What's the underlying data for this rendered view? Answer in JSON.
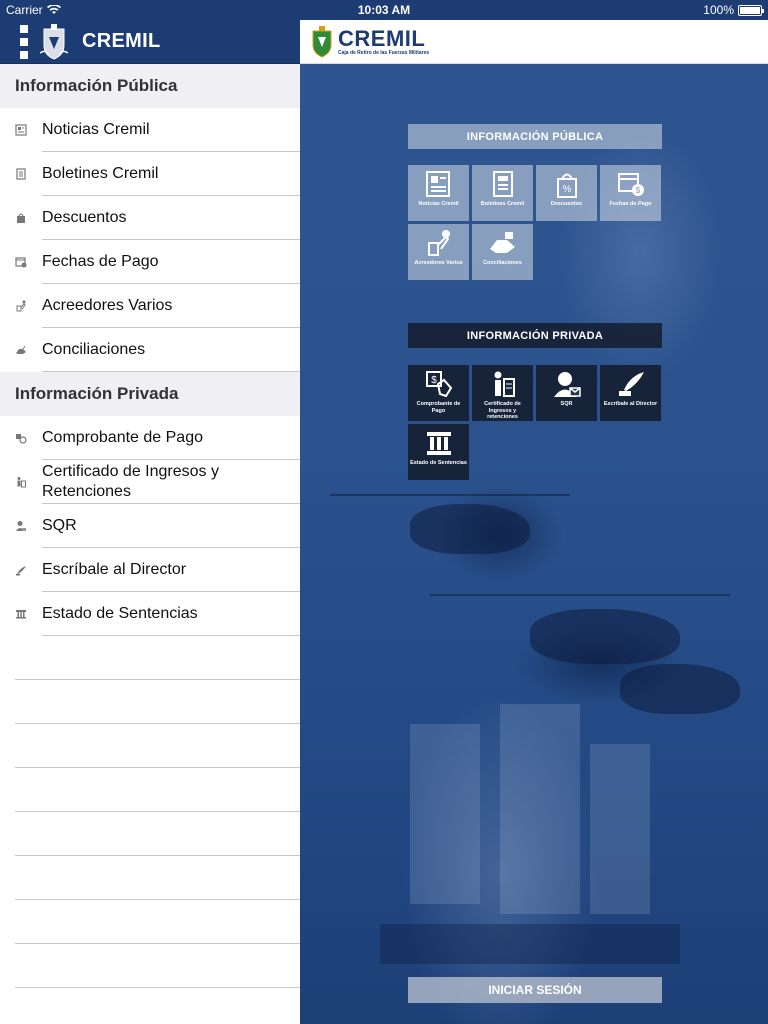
{
  "status_bar": {
    "carrier": "Carrier",
    "time": "10:03 AM",
    "battery": "100%"
  },
  "sidebar": {
    "title": "CREMIL",
    "sections": [
      {
        "heading": "Información Pública",
        "items": [
          {
            "label": "Noticias Cremil",
            "icon": "newspaper-icon"
          },
          {
            "label": "Boletines Cremil",
            "icon": "bulletin-icon"
          },
          {
            "label": "Descuentos",
            "icon": "discount-bag-icon"
          },
          {
            "label": "Fechas de Pago",
            "icon": "calendar-icon"
          },
          {
            "label": "Acreedores Varios",
            "icon": "hand-money-icon"
          },
          {
            "label": "Conciliaciones",
            "icon": "handshake-icon"
          }
        ]
      },
      {
        "heading": "Información Privada",
        "items": [
          {
            "label": "Comprobante de Pago",
            "icon": "receipt-icon"
          },
          {
            "label": "Certificado de Ingresos y Retenciones",
            "icon": "certificate-icon"
          },
          {
            "label": "SQR",
            "icon": "person-mail-icon"
          },
          {
            "label": "Escríbale al Director",
            "icon": "quill-icon"
          },
          {
            "label": "Estado de Sentencias",
            "icon": "courthouse-icon"
          }
        ]
      }
    ]
  },
  "topbar": {
    "logo_text": "CREMIL",
    "logo_subtitle": "Caja de Retiro de las Fuerzas Militares"
  },
  "main": {
    "publica_title": "INFORMACIÓN PÚBLICA",
    "publica_tiles": [
      {
        "label": "Noticias Cremil",
        "icon": "newspaper-icon"
      },
      {
        "label": "Boletines Cremil",
        "icon": "bulletin-icon"
      },
      {
        "label": "Descuentos",
        "icon": "discount-bag-icon"
      },
      {
        "label": "Fechas de Pago",
        "icon": "calendar-icon"
      },
      {
        "label": "Acreedores Varios",
        "icon": "hand-money-icon"
      },
      {
        "label": "Conciliaciones",
        "icon": "handshake-icon"
      }
    ],
    "privada_title": "INFORMACIÓN PRIVADA",
    "privada_tiles": [
      {
        "label": "Comprobante de Pago",
        "icon": "receipt-icon"
      },
      {
        "label": "Certificado de Ingresos y retenciones",
        "icon": "certificate-icon"
      },
      {
        "label": "SQR",
        "icon": "person-mail-icon"
      },
      {
        "label": "Escríbale al Director",
        "icon": "quill-icon"
      },
      {
        "label": "Estado de Sentencias",
        "icon": "courthouse-icon"
      }
    ],
    "login_button": "INICIAR SESIÓN"
  },
  "colors": {
    "brand_blue": "#1c3c73",
    "background_blue": "#2b528d"
  }
}
